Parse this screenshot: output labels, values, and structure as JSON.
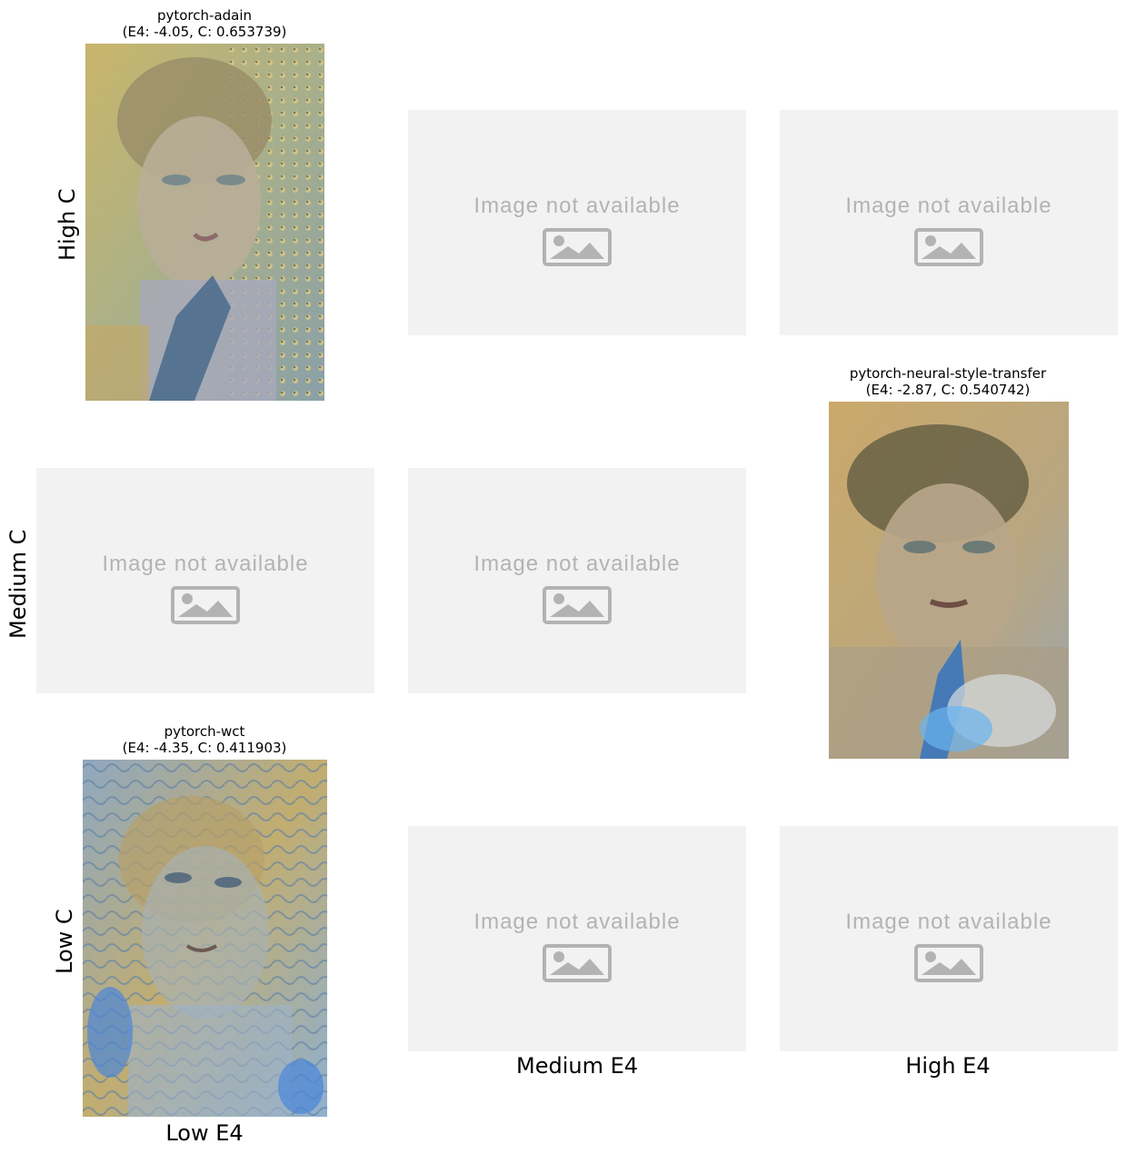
{
  "cells": {
    "r0c0": {
      "method": "pytorch-adain",
      "stats": "(E4: -4.05, C: 0.653739)"
    },
    "r1c2": {
      "method": "pytorch-neural-style-transfer",
      "stats": "(E4: -2.87, C: 0.540742)"
    },
    "r2c0": {
      "method": "pytorch-wct",
      "stats": "(E4: -4.35, C: 0.411903)"
    }
  },
  "placeholder_text": "Image not available",
  "row_labels": [
    "High C",
    "Medium C",
    "Low C"
  ],
  "col_labels": [
    "Low E4",
    "Medium E4",
    "High E4"
  ],
  "colors": {
    "placeholder_bg": "#f2f2f2",
    "placeholder_fg": "#b3b3b3"
  }
}
